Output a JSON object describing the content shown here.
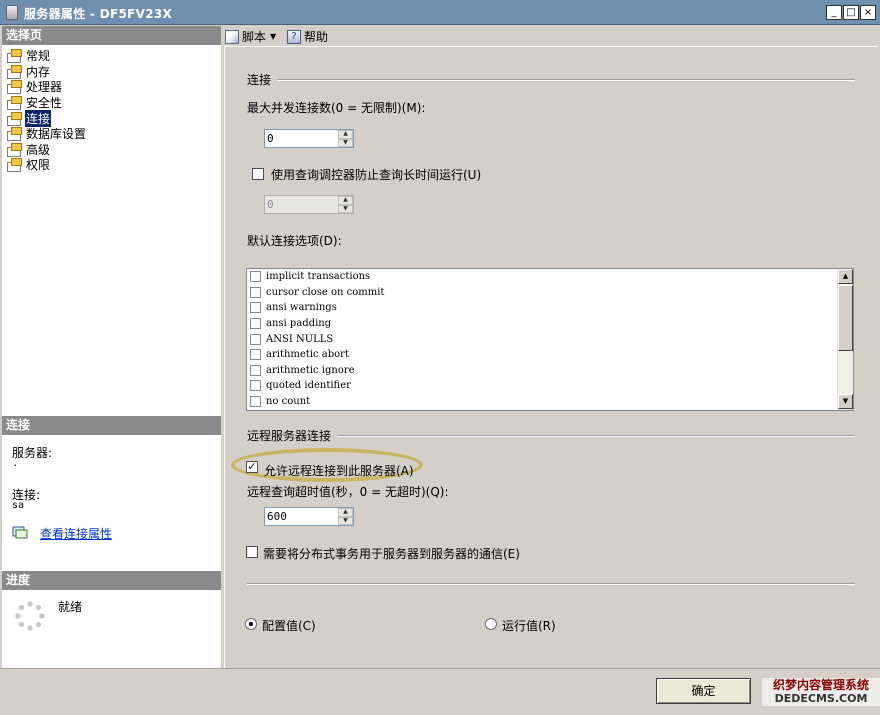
{
  "window": {
    "title": "服务器属性 - DF5FV23X",
    "minimize": "_",
    "maximize": "□",
    "close": "×"
  },
  "left": {
    "pages_header": "选择页",
    "pages": [
      {
        "label": "常规",
        "icon": "page-icon"
      },
      {
        "label": "内存",
        "icon": "page-icon"
      },
      {
        "label": "处理器",
        "icon": "page-icon"
      },
      {
        "label": "安全性",
        "icon": "page-icon"
      },
      {
        "label": "连接",
        "icon": "page-icon",
        "selected": true
      },
      {
        "label": "数据库设置",
        "icon": "page-icon"
      },
      {
        "label": "高级",
        "icon": "page-icon"
      },
      {
        "label": "权限",
        "icon": "page-icon"
      }
    ],
    "connection_header": "连接",
    "server_label": "服务器:",
    "server_value": ".",
    "connection_label": "连接:",
    "connection_value": "sa",
    "view_link": "查看连接属性",
    "progress_header": "进度",
    "status": "就绪"
  },
  "toolbar": {
    "script_label": "脚本",
    "help_label": "帮助"
  },
  "main": {
    "connection_group": "连接",
    "max_conn_label": "最大并发连接数(0 = 无限制)(M):",
    "max_conn_value": "0",
    "query_governor_label": "使用查询调控器防止查询长时间运行(U)",
    "query_governor_checked": false,
    "query_governor_value": "0",
    "default_options_label": "默认连接选项(D):",
    "default_options": [
      {
        "label": "implicit transactions",
        "checked": false
      },
      {
        "label": "cursor close on commit",
        "checked": false
      },
      {
        "label": "ansi warnings",
        "checked": false
      },
      {
        "label": "ansi padding",
        "checked": false
      },
      {
        "label": "ANSI NULLS",
        "checked": false
      },
      {
        "label": "arithmetic abort",
        "checked": false
      },
      {
        "label": "arithmetic ignore",
        "checked": false
      },
      {
        "label": "quoted identifier",
        "checked": false
      },
      {
        "label": "no count",
        "checked": false
      }
    ],
    "remote_group": "远程服务器连接",
    "allow_remote_label": "允许远程连接到此服务器(A)",
    "allow_remote_checked": true,
    "remote_timeout_label": "远程查询超时值(秒，0 = 无超时)(Q):",
    "remote_timeout_value": "600",
    "distributed_label": "需要将分布式事务用于服务器到服务器的通信(E)",
    "distributed_checked": false,
    "config_value_label": "配置值(C)",
    "running_value_label": "运行值(R)",
    "selected_mode": "config"
  },
  "footer": {
    "ok_label": "确定",
    "watermark_line1": "织梦内容管理系统",
    "watermark_line2": "DEDECMS.COM"
  },
  "colors": {
    "title_bar": "#6f8fae",
    "selected_item": "#0a246a",
    "section_header": "#8a8a8a",
    "link": "#0033cc",
    "highlight_ring": "#c4aa36"
  }
}
